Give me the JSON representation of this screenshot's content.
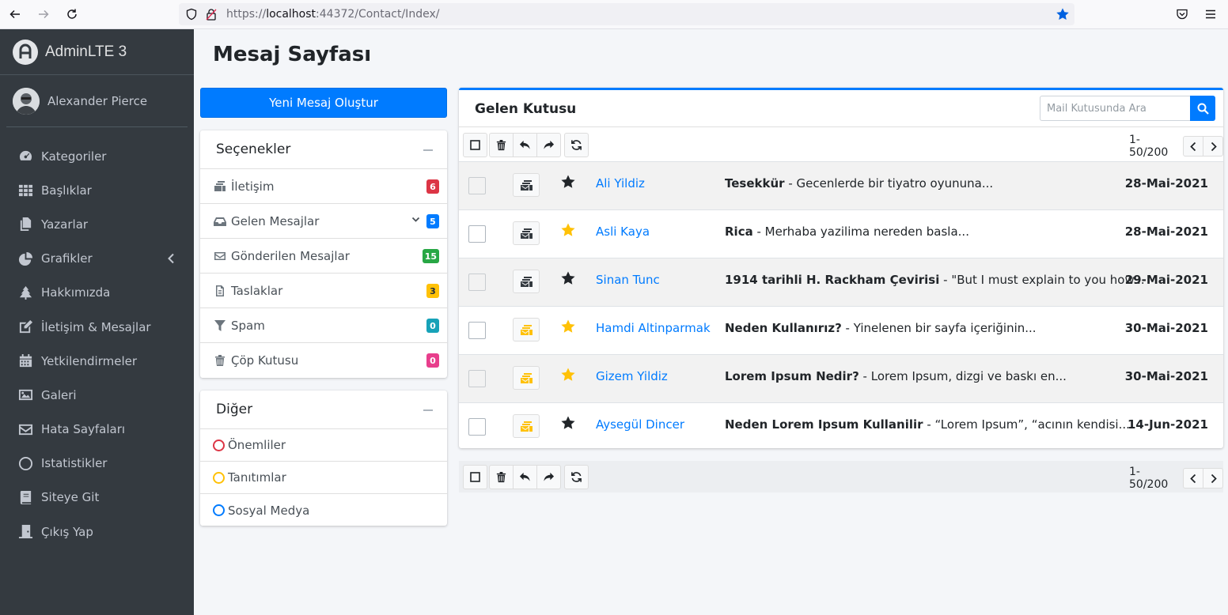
{
  "browser": {
    "url_prefix": "https://",
    "url_host": "localhost",
    "url_path": ":44372/Contact/Index/"
  },
  "sidebar": {
    "brand": "AdminLTE 3",
    "user": "Alexander Pierce",
    "items": [
      {
        "label": "Kategoriler",
        "icon": "tachometer-icon"
      },
      {
        "label": "Başlıklar",
        "icon": "grid-icon"
      },
      {
        "label": "Yazarlar",
        "icon": "copy-icon"
      },
      {
        "label": "Grafikler",
        "icon": "pie-chart-icon"
      },
      {
        "label": "Hakkımızda",
        "icon": "tree-icon"
      },
      {
        "label": "İletişim & Mesajlar",
        "icon": "edit-icon"
      },
      {
        "label": "Yetkilendirmeler",
        "icon": "calendar-icon"
      },
      {
        "label": "Galeri",
        "icon": "image-icon"
      },
      {
        "label": "Hata Sayfaları",
        "icon": "envelope-icon"
      },
      {
        "label": "Istatistikler",
        "icon": "circle-icon"
      },
      {
        "label": "Siteye Git",
        "icon": "book-icon"
      },
      {
        "label": "Çıkış Yap",
        "icon": "door-icon"
      }
    ]
  },
  "page": {
    "title": "Mesaj Sayfası",
    "new_button": "Yeni Mesaj Oluştur"
  },
  "options": {
    "title": "Seçenekler",
    "folders": [
      {
        "label": "İletişim",
        "count": "6",
        "color": "#dc3545"
      },
      {
        "label": "Gelen Mesajlar",
        "count": "5",
        "color": "#007bff"
      },
      {
        "label": "Gönderilen Mesajlar",
        "count": "15",
        "color": "#28a745"
      },
      {
        "label": "Taslaklar",
        "count": "3",
        "color": "#ffc107"
      },
      {
        "label": "Spam",
        "count": "0",
        "color": "#17a2b8"
      },
      {
        "label": "Çöp Kutusu",
        "count": "0",
        "color": "#e83e8c"
      }
    ]
  },
  "other": {
    "title": "Diğer",
    "labels": [
      {
        "label": "Önemliler",
        "color": "#dc3545"
      },
      {
        "label": "Tanıtımlar",
        "color": "#ffc107"
      },
      {
        "label": "Sosyal Medya",
        "color": "#007bff"
      }
    ]
  },
  "mailbox": {
    "title": "Gelen Kutusu",
    "search_placeholder": "Mail Kutusunda Ara",
    "pager": "1-50/200",
    "rows": [
      {
        "name": "Ali Yildiz",
        "subject": "Tesekkür",
        "preview": " - Gecenlerde bir tiyatro oyununa...",
        "date": "28-Mai-2021",
        "starred": false,
        "type_color": "#343a40"
      },
      {
        "name": "Asli Kaya",
        "subject": "Rica",
        "preview": " - Merhaba yazilima nereden basla...",
        "date": "28-Mai-2021",
        "starred": true,
        "type_color": "#343a40"
      },
      {
        "name": "Sinan Tunc",
        "subject": "1914 tarihli H. Rackham Çevirisi",
        "preview": " - \"But I must explain to you how...",
        "date": "29-Mai-2021",
        "starred": false,
        "type_color": "#343a40"
      },
      {
        "name": "Hamdi Altinparmak",
        "subject": "Neden Kullanırız?",
        "preview": " - Yinelenen bir sayfa içeriğinin...",
        "date": "30-Mai-2021",
        "starred": true,
        "type_color": "#ffc107"
      },
      {
        "name": "Gizem Yildiz",
        "subject": "Lorem Ipsum Nedir?",
        "preview": " - Lorem Ipsum, dizgi ve baskı en...",
        "date": "30-Mai-2021",
        "starred": true,
        "type_color": "#ffc107"
      },
      {
        "name": "Aysegül Dincer",
        "subject": "Neden Lorem Ipsum Kullanilir",
        "preview": " - “Lorem Ipsum”, “acının kendisi...",
        "date": "14-Jun-2021",
        "starred": false,
        "type_color": "#ffc107"
      }
    ]
  },
  "colors": {
    "accent": "#007bff",
    "sidebar_bg": "#343a40",
    "star_gold": "#ffc107",
    "star_dark": "#212529"
  }
}
